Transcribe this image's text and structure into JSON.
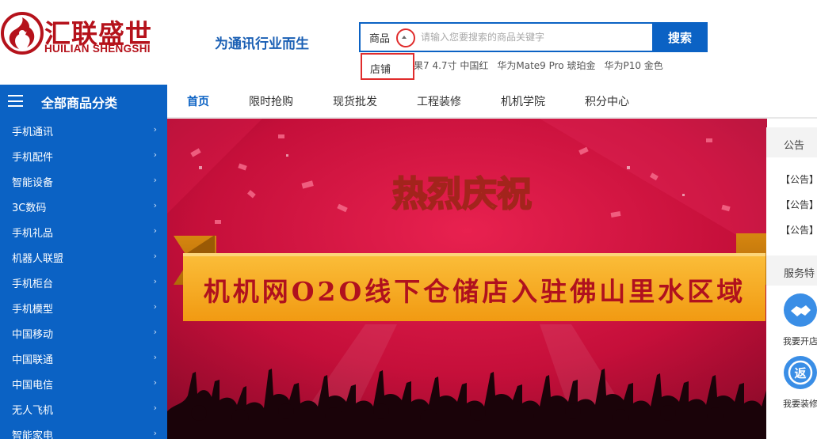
{
  "brand": {
    "name_cn": "汇联盛世",
    "name_en": "HUILIAN SHENGSHI",
    "slogan": "为通讯行业而生",
    "color": "#b5121b"
  },
  "search": {
    "type_selected": "商品",
    "placeholder": "请输入您要搜索的商品关键字",
    "button_label": "搜索",
    "dropdown_option": "店铺",
    "hot_words": [
      "果7 4.7寸 中国红",
      "华为Mate9 Pro 琥珀金",
      "华为P10 金色"
    ]
  },
  "category_nav": {
    "title": "全部商品分类",
    "items": [
      "手机通讯",
      "手机配件",
      "智能设备",
      "3C数码",
      "手机礼品",
      "机器人联盟",
      "手机柜台",
      "手机模型",
      "中国移动",
      "中国联通",
      "中国电信",
      "无人飞机",
      "智能家电"
    ]
  },
  "main_nav": [
    "首页",
    "限时抢购",
    "现货批发",
    "工程装修",
    "机机学院",
    "积分中心"
  ],
  "banner": {
    "headline": "热烈庆祝",
    "ribbon_text": "机机网O2O线下仓储店入驻佛山里水区域"
  },
  "sidepanel": {
    "announce_tab": "公告",
    "announce_items": [
      "【公告】",
      "【公告】",
      "【公告】"
    ],
    "service_tab": "服务特",
    "services": [
      {
        "icon": "handshake-icon",
        "label": "我要开店"
      },
      {
        "icon": "return-icon",
        "icon_text": "返",
        "label": "我要装修"
      }
    ]
  },
  "colors": {
    "primary": "#0b62c4",
    "accent": "#e02c2c",
    "banner_bg": "#c8113b",
    "ribbon": "#f4a81e"
  }
}
